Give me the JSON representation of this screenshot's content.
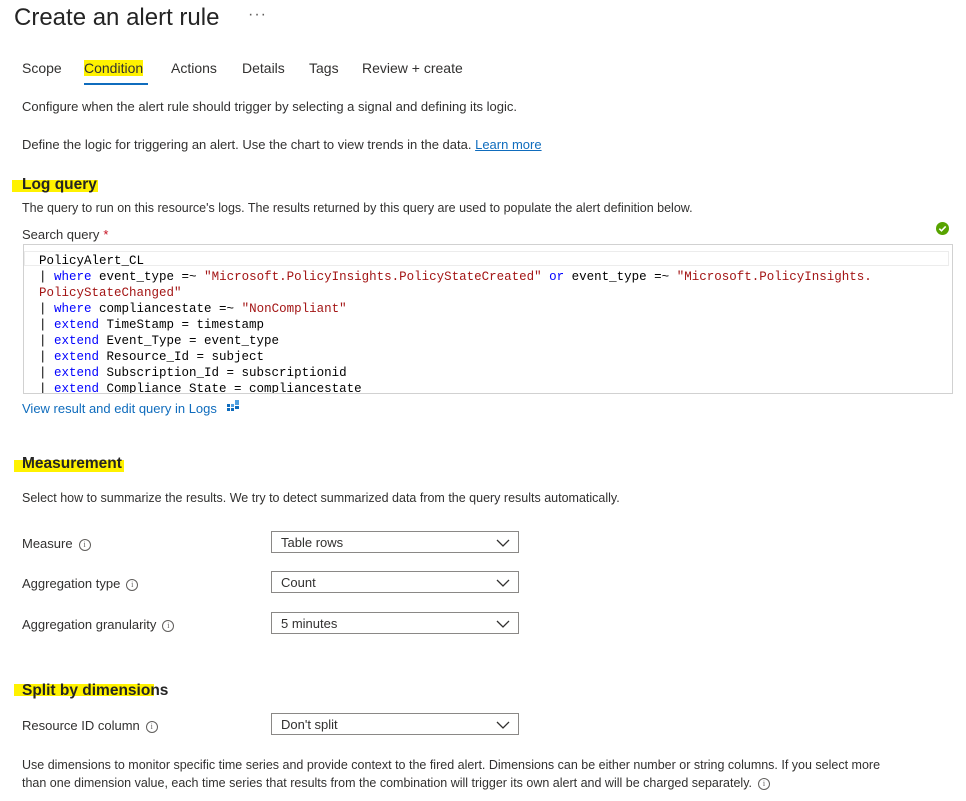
{
  "header": {
    "title": "Create an alert rule",
    "more_label": "···"
  },
  "tabs": [
    {
      "label": "Scope"
    },
    {
      "label": "Condition"
    },
    {
      "label": "Actions"
    },
    {
      "label": "Details"
    },
    {
      "label": "Tags"
    },
    {
      "label": "Review + create"
    }
  ],
  "intro": {
    "configure_text": "Configure when the alert rule should trigger by selecting a signal and defining its logic.",
    "define_text": "Define the logic for triggering an alert. Use the chart to view trends in the data.",
    "learn_more": "Learn more"
  },
  "log_query": {
    "heading": "Log query",
    "description": "The query to run on this resource's logs. The results returned by this query are used to populate the alert definition below.",
    "search_label": "Search query",
    "required_mark": "*",
    "status_icon": "check-circle-icon",
    "code_lines": [
      "PolicyAlert_CL",
      "| where event_type =~ \"Microsoft.PolicyInsights.PolicyStateCreated\" or event_type =~ \"Microsoft.PolicyInsights.",
      "PolicyStateChanged\"",
      "| where compliancestate =~ \"NonCompliant\"",
      "| extend TimeStamp = timestamp",
      "| extend Event_Type = event_type",
      "| extend Resource_Id = subject",
      "| extend Subscription_Id = subscriptionid",
      "| extend Compliance_State = compliancestate"
    ],
    "view_logs_link": "View result and edit query in Logs"
  },
  "measurement": {
    "heading": "Measurement",
    "description": "Select how to summarize the results. We try to detect summarized data from the query results automatically.",
    "fields": [
      {
        "label": "Measure",
        "value": "Table rows"
      },
      {
        "label": "Aggregation type",
        "value": "Count"
      },
      {
        "label": "Aggregation granularity",
        "value": "5 minutes"
      }
    ]
  },
  "split": {
    "heading": "Split by dimensions",
    "resource_label": "Resource ID column",
    "resource_value": "Don't split",
    "description_line1": "Use dimensions to monitor specific time series and provide context to the fired alert. Dimensions can be either number or string columns. If you select more",
    "description_line2": "than one dimension value, each time series that results from the combination will trigger its own alert and will be charged separately."
  },
  "colors": {
    "highlight": "#fff200",
    "accent": "#0f6cbd",
    "success": "#57a300",
    "keyword": "#0000ff",
    "string": "#a31515"
  }
}
